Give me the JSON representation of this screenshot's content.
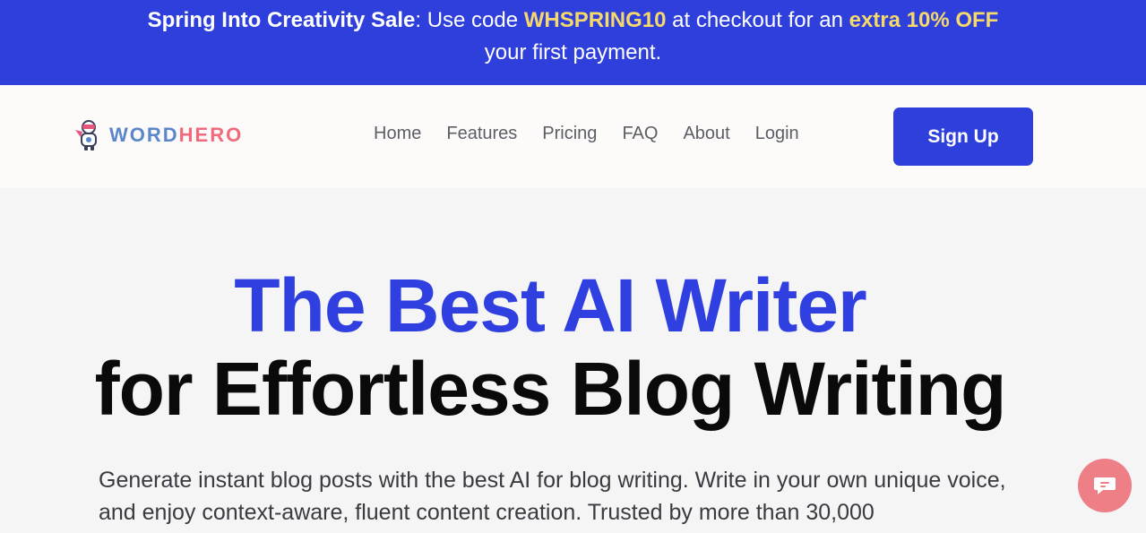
{
  "promo": {
    "sale_name": "Spring Into Creativity Sale",
    "text_a": ": Use code ",
    "code": "WHSPRING10",
    "text_b": " at checkout for an ",
    "offer": "extra 10% OFF",
    "text_c": "your first payment."
  },
  "logo": {
    "word_part": "WORD",
    "hero_part": "HERO"
  },
  "nav": {
    "links": [
      "Home",
      "Features",
      "Pricing",
      "FAQ",
      "About",
      "Login"
    ],
    "signup_label": "Sign Up"
  },
  "hero": {
    "title_line1": "The Best AI Writer",
    "title_line2": "for Effortless Blog Writing",
    "subtitle": "Generate instant blog posts with the best AI for blog writing. Write in your own unique voice, and enjoy context-aware, fluent content creation. Trusted by more than 30,000"
  },
  "colors": {
    "brand_blue": "#2f3fdb",
    "highlight_yellow": "#f5d96b",
    "logo_blue": "#5b86c9",
    "logo_pink": "#f06a7c",
    "chat_pink": "#ee7f86"
  },
  "icons": {
    "logo": "robot-hero-icon",
    "chat": "chat-bubble-icon"
  }
}
